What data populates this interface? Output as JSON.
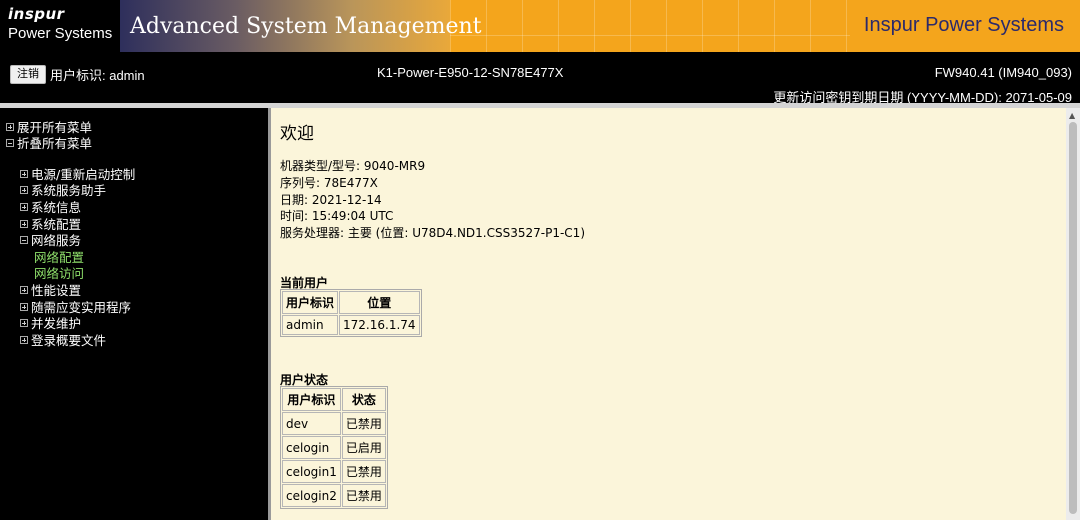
{
  "banner": {
    "logo_line1": "inspur",
    "logo_line2": "Power Systems",
    "app_title": "Advanced System Management",
    "brand_right": "Inspur Power Systems"
  },
  "topbar": {
    "logout_label": "注销",
    "user_label": "用户标识: admin",
    "system_name": "K1-Power-E950-12-SN78E477X",
    "fw_version": "FW940.41 (IM940_093)",
    "key_expiry": "更新访问密钥到期日期 (YYYY-MM-DD): 2071-05-09"
  },
  "sidebar": {
    "expand_all": "展开所有菜单",
    "collapse_all": "折叠所有菜单",
    "items": [
      {
        "label": "电源/重新启动控制",
        "icon": "plus"
      },
      {
        "label": "系统服务助手",
        "icon": "plus"
      },
      {
        "label": "系统信息",
        "icon": "plus"
      },
      {
        "label": "系统配置",
        "icon": "plus"
      },
      {
        "label": "网络服务",
        "icon": "minus"
      },
      {
        "label": "网络配置",
        "icon": "none"
      },
      {
        "label": "网络访问",
        "icon": "none"
      },
      {
        "label": "性能设置",
        "icon": "plus"
      },
      {
        "label": "随需应变实用程序",
        "icon": "plus"
      },
      {
        "label": "并发维护",
        "icon": "plus"
      },
      {
        "label": "登录概要文件",
        "icon": "plus"
      }
    ]
  },
  "main": {
    "welcome": "欢迎",
    "machine_type": "机器类型/型号: 9040-MR9",
    "serial": "序列号: 78E477X",
    "date": "日期: 2021-12-14",
    "time": "时间: 15:49:04 UTC",
    "service_processor": "服务处理器: 主要 (位置: U78D4.ND1.CSS3527-P1-C1)",
    "current_user_title": "当前用户",
    "current_user_headers": [
      "用户标识",
      "位置"
    ],
    "current_user_row": [
      "admin",
      "172.16.1.74"
    ],
    "user_status_title": "用户状态",
    "user_status_headers": [
      "用户标识",
      "状态"
    ],
    "user_status_rows": [
      [
        "dev",
        "已禁用"
      ],
      [
        "celogin",
        "已启用"
      ],
      [
        "celogin1",
        "已禁用"
      ],
      [
        "celogin2",
        "已禁用"
      ]
    ]
  },
  "colors": {
    "banner_orange": "#F4A51C",
    "content_bg": "#FBF5DA",
    "sub_link_green": "#8fe06b",
    "brand_text": "#2b2a6b"
  }
}
